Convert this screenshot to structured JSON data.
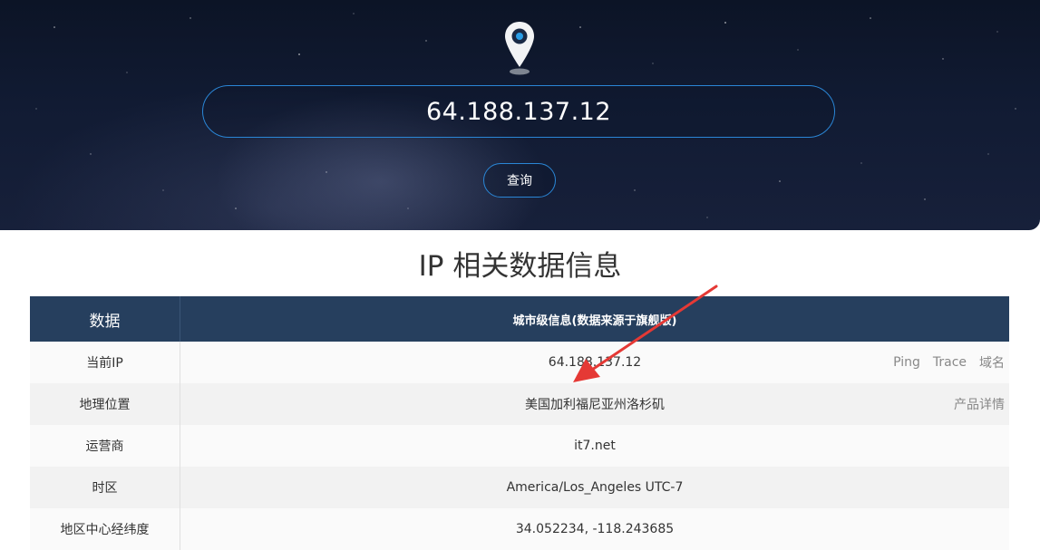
{
  "hero": {
    "search_value": "64.188.137.12",
    "query_label": "查询"
  },
  "section": {
    "title": "IP 相关数据信息"
  },
  "table": {
    "header_key": "数据",
    "header_value": "城市级信息(数据来源于旗舰版)",
    "rows": [
      {
        "key": "当前IP",
        "value": "64.188.137.12",
        "actions": [
          "Ping",
          "Trace",
          "域名"
        ]
      },
      {
        "key": "地理位置",
        "value": "美国加利福尼亚州洛杉矶",
        "actions": [
          "产品详情"
        ]
      },
      {
        "key": "运营商",
        "value": "it7.net"
      },
      {
        "key": "时区",
        "value": "America/Los_Angeles UTC-7"
      },
      {
        "key": "地区中心经纬度",
        "value": "34.052234, -118.243685"
      }
    ]
  },
  "colors": {
    "header_bg": "#263f5e",
    "accent_border": "#2a86d6",
    "arrow": "#e53935"
  }
}
